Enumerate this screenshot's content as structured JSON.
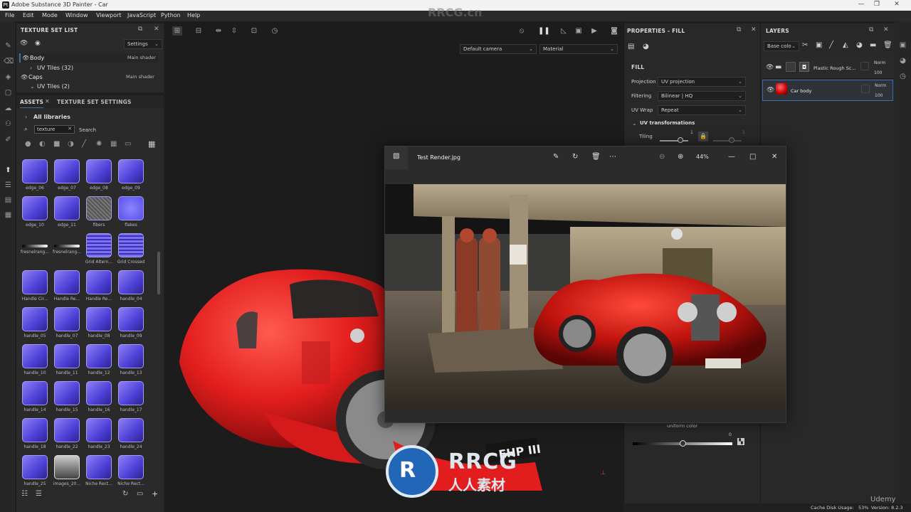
{
  "window": {
    "title": "Adobe Substance 3D Painter - Car",
    "app_icon": "Pt",
    "minimize": "—",
    "maximize": "❐",
    "close": "✕"
  },
  "menu": [
    "File",
    "Edit",
    "Mode",
    "Window",
    "Viewport",
    "JavaScript",
    "Python",
    "Help"
  ],
  "texture_set_list": {
    "title": "TEXTURE SET LIST",
    "settings_label": "Settings",
    "items": [
      {
        "name": "Body",
        "shader": "Main shader",
        "sub": "UV Tiles (32)"
      },
      {
        "name": "Caps",
        "shader": "Main shader",
        "sub": "UV Tiles (2)"
      }
    ]
  },
  "assets": {
    "tab_assets": "ASSETS",
    "tab_settings": "TEXTURE SET SETTINGS",
    "all_libraries": "All libraries",
    "search_value": "texture",
    "search_label": "Search",
    "tiles": [
      {
        "label": "edge_06"
      },
      {
        "label": "edge_07"
      },
      {
        "label": "edge_08"
      },
      {
        "label": "edge_09"
      },
      {
        "label": "edge_10"
      },
      {
        "label": "edge_11"
      },
      {
        "label": "fibers"
      },
      {
        "label": "flakes"
      },
      {
        "label": "fresnelrang..."
      },
      {
        "label": "fresnelrang..."
      },
      {
        "label": "Grid Altern..."
      },
      {
        "label": "Grid Crossed"
      },
      {
        "label": "Handle Cir..."
      },
      {
        "label": "Handle Re..."
      },
      {
        "label": "Handle Re..."
      },
      {
        "label": "handle_04"
      },
      {
        "label": "handle_05"
      },
      {
        "label": "handle_07"
      },
      {
        "label": "handle_08"
      },
      {
        "label": "handle_09"
      },
      {
        "label": "handle_10"
      },
      {
        "label": "handle_11"
      },
      {
        "label": "handle_12"
      },
      {
        "label": "handle_13"
      },
      {
        "label": "handle_14"
      },
      {
        "label": "handle_15"
      },
      {
        "label": "handle_16"
      },
      {
        "label": "handle_17"
      },
      {
        "label": "handle_18"
      },
      {
        "label": "handle_22"
      },
      {
        "label": "handle_23"
      },
      {
        "label": "handle_24"
      },
      {
        "label": "handle_25"
      },
      {
        "label": "images_20..."
      },
      {
        "label": "Niche Rect..."
      },
      {
        "label": "Niche Rect..."
      }
    ]
  },
  "viewport": {
    "camera": "Default camera",
    "mode": "Material",
    "plate": "EHP III"
  },
  "properties": {
    "title": "PROPERTIES - FILL",
    "section": "FILL",
    "projection_label": "Projection",
    "projection_value": "UV projection",
    "filtering_label": "Filtering",
    "filtering_value": "Bilinear | HQ",
    "uvwrap_label": "UV Wrap",
    "uvwrap_value": "Repeat",
    "uv_transform": "UV transformations",
    "tiling_label": "Tiling",
    "tiling_value": "1",
    "tiling_value_2": "1",
    "uniform_color": "uniform color",
    "slider_value": "0"
  },
  "layers": {
    "title": "LAYERS",
    "channel": "Base colo",
    "items": [
      {
        "name": "Plastic Rough Sc...",
        "blend": "Norm",
        "opacity": "100"
      },
      {
        "name": "Car body",
        "blend": "Norm",
        "opacity": "100"
      }
    ]
  },
  "photo_viewer": {
    "filename": "Test Render.jpg",
    "zoom": "44%"
  },
  "status": {
    "cache": "Cache Disk Usage:",
    "cache_value": "53%",
    "version": "Version: 8.2.3"
  },
  "watermarks": {
    "brand": "RRCG",
    "cn": "人人素材",
    "top_url": "RRCG.cn",
    "udemy": "Udemy"
  },
  "colors": {
    "accent": "#3a6fb5",
    "car_red": "#e11d1d",
    "tile_purple": "#6b5cf0"
  }
}
